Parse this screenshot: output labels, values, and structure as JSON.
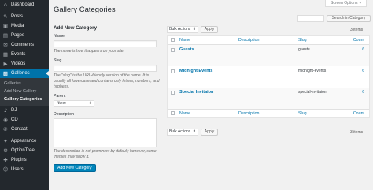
{
  "sidebar": {
    "items": [
      {
        "label": "Dashboard",
        "icon": "⌂"
      },
      {
        "label": "Posts",
        "icon": "✎"
      },
      {
        "label": "Media",
        "icon": "▣"
      },
      {
        "label": "Pages",
        "icon": "▤"
      },
      {
        "label": "Comments",
        "icon": "✉"
      },
      {
        "label": "Events",
        "icon": "▦"
      },
      {
        "label": "Videos",
        "icon": "▶"
      },
      {
        "label": "Galleries",
        "icon": "▩"
      }
    ],
    "submenu": [
      "Galleries",
      "Add New Gallery",
      "Gallery Categories"
    ],
    "items_after": [
      {
        "label": "DJ",
        "icon": "♪"
      },
      {
        "label": "CD",
        "icon": "◉"
      },
      {
        "label": "Contact",
        "icon": "✆"
      }
    ],
    "items_bottom": [
      {
        "label": "Appearance",
        "icon": "✦"
      },
      {
        "label": "OptionTree",
        "icon": "⚙"
      },
      {
        "label": "Plugins",
        "icon": "✚"
      },
      {
        "label": "Users",
        "icon": "☺"
      }
    ]
  },
  "header": {
    "screen_options": "Screen Options",
    "screen_options_arrow": "▾",
    "title": "Gallery Categories"
  },
  "search": {
    "button_label": "Search in Category"
  },
  "form": {
    "heading": "Add New Category",
    "name_label": "Name",
    "name_desc": "The name is how it appears on your site.",
    "slug_label": "Slug",
    "slug_desc": "The \"slug\" is the URL-friendly version of the name. It is usually all lowercase and contains only letters, numbers, and hyphens.",
    "parent_label": "Parent",
    "parent_value": "None",
    "description_label": "Description",
    "description_desc": "The description is not prominent by default; however, some themes may show it.",
    "submit_label": "Add New Category"
  },
  "table": {
    "bulk_actions": "Bulk Actions",
    "apply": "Apply",
    "items_count": "3 items",
    "columns": {
      "name": "Name",
      "description": "Description",
      "slug": "Slug",
      "count": "Count"
    },
    "rows": [
      {
        "name": "Guests",
        "slug": "guests",
        "count": "6"
      },
      {
        "name": "Midnight Events",
        "slug": "midnight-events",
        "count": "6"
      },
      {
        "name": "Special Invitaion",
        "slug": "special-invitaion",
        "count": "6"
      }
    ]
  },
  "colors": {
    "accent": "#0073aa",
    "sidebar_bg": "#23282d",
    "primary_button": "#0085ba"
  }
}
